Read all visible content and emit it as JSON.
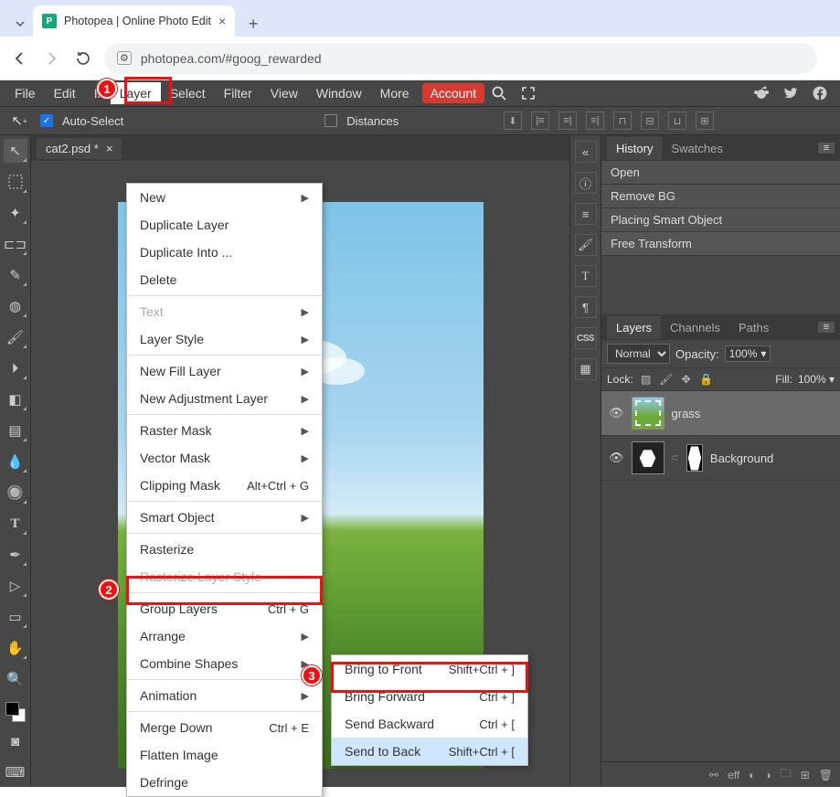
{
  "browser": {
    "tab_title": "Photopea | Online Photo Edit",
    "url": "photopea.com/#goog_rewarded"
  },
  "menubar": {
    "items": [
      "File",
      "Edit",
      "Image",
      "Layer",
      "Select",
      "Filter",
      "View",
      "Window",
      "More"
    ],
    "account": "Account"
  },
  "options_bar": {
    "auto_select": "Auto-Select",
    "distances": "Distances"
  },
  "document": {
    "tab": "cat2.psd *"
  },
  "layer_menu": {
    "items": [
      {
        "label": "New",
        "sub": true
      },
      {
        "label": "Duplicate Layer"
      },
      {
        "label": "Duplicate Into ..."
      },
      {
        "label": "Delete"
      },
      {
        "sep": true
      },
      {
        "label": "Text",
        "sub": true,
        "disabled": true
      },
      {
        "label": "Layer Style",
        "sub": true
      },
      {
        "sep": true
      },
      {
        "label": "New Fill Layer",
        "sub": true
      },
      {
        "label": "New Adjustment Layer",
        "sub": true
      },
      {
        "sep": true
      },
      {
        "label": "Raster Mask",
        "sub": true
      },
      {
        "label": "Vector Mask",
        "sub": true
      },
      {
        "label": "Clipping Mask",
        "shortcut": "Alt+Ctrl + G"
      },
      {
        "sep": true
      },
      {
        "label": "Smart Object",
        "sub": true
      },
      {
        "sep": true
      },
      {
        "label": "Rasterize"
      },
      {
        "label": "Rasterize Layer Style",
        "disabled": true
      },
      {
        "sep": true
      },
      {
        "label": "Group Layers",
        "shortcut": "Ctrl + G"
      },
      {
        "label": "Arrange",
        "sub": true
      },
      {
        "label": "Combine Shapes",
        "sub": true
      },
      {
        "sep": true
      },
      {
        "label": "Animation",
        "sub": true
      },
      {
        "sep": true
      },
      {
        "label": "Merge Down",
        "shortcut": "Ctrl + E"
      },
      {
        "label": "Flatten Image"
      },
      {
        "label": "Defringe"
      }
    ]
  },
  "arrange_menu": {
    "items": [
      {
        "label": "Bring to Front",
        "shortcut": "Shift+Ctrl + ]"
      },
      {
        "label": "Bring Forward",
        "shortcut": "Ctrl + ]"
      },
      {
        "label": "Send Backward",
        "shortcut": "Ctrl + ["
      },
      {
        "label": "Send to Back",
        "shortcut": "Shift+Ctrl + [",
        "hover": true
      }
    ]
  },
  "history_panel": {
    "tabs": [
      "History",
      "Swatches"
    ],
    "items": [
      "Open",
      "Remove BG",
      "Placing Smart Object",
      "Free Transform"
    ]
  },
  "layers_panel": {
    "tabs": [
      "Layers",
      "Channels",
      "Paths"
    ],
    "blend_mode": "Normal",
    "opacity_label": "Opacity:",
    "opacity_value": "100%",
    "lock_label": "Lock:",
    "fill_label": "Fill:",
    "fill_value": "100%",
    "layers": [
      {
        "name": "grass",
        "selected": true
      },
      {
        "name": "Background"
      }
    ]
  },
  "annotations": {
    "m1": "1",
    "m2": "2",
    "m3": "3"
  },
  "icons": {
    "eff": "eff"
  }
}
